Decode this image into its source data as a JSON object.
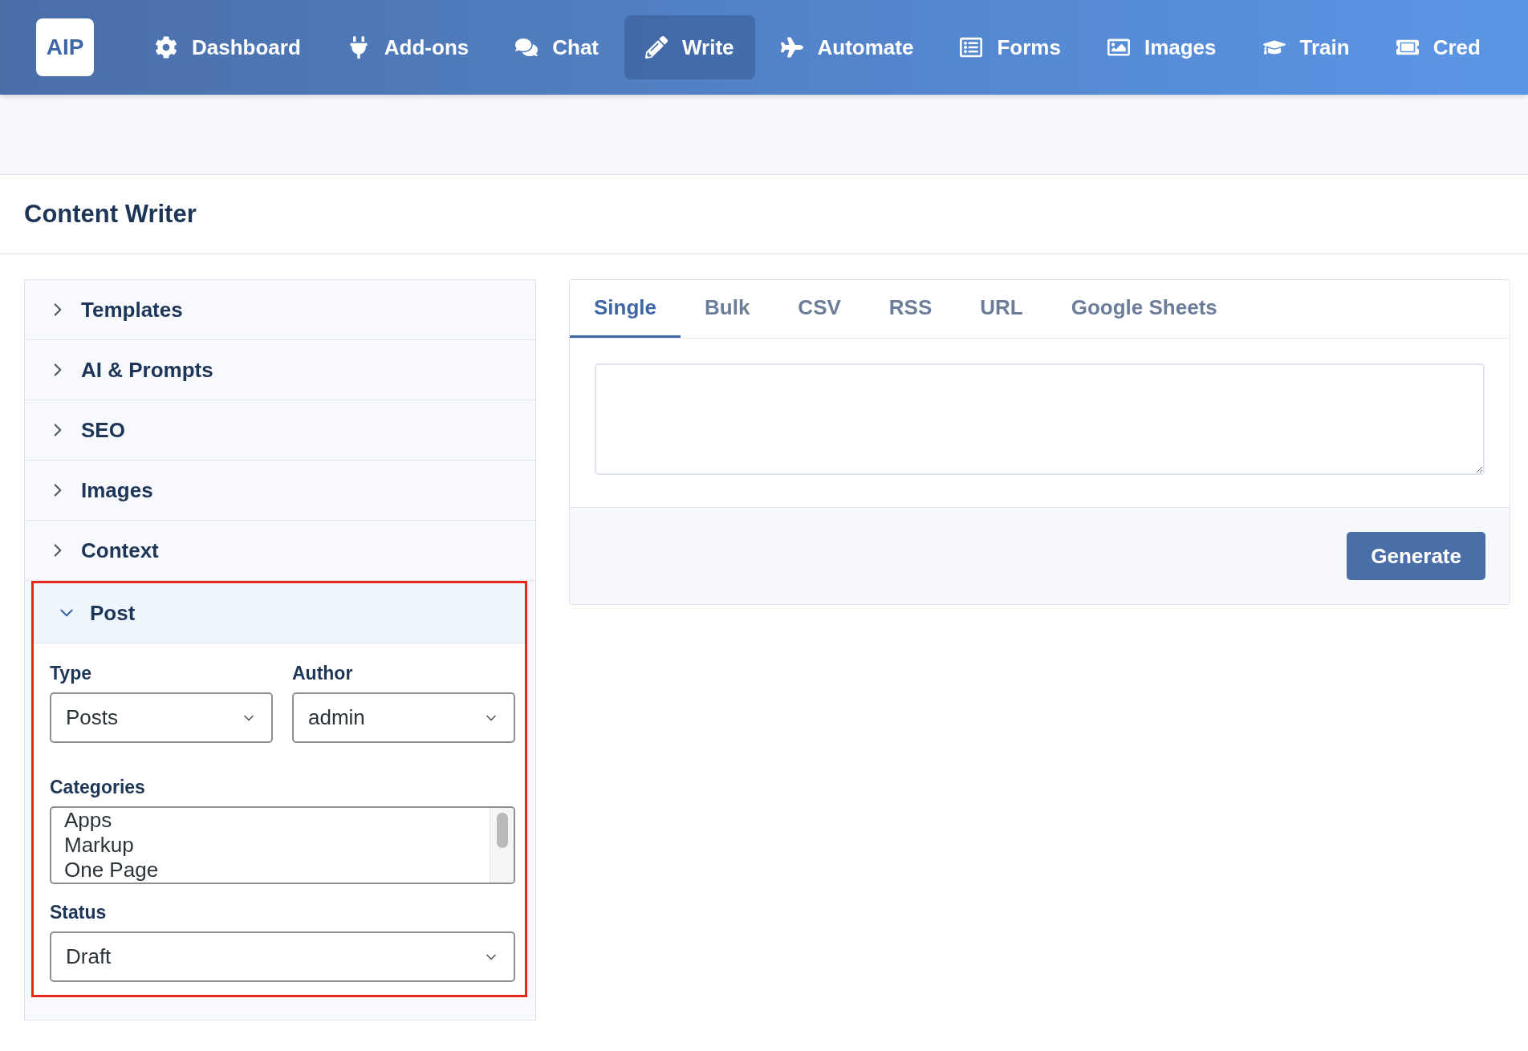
{
  "logo": "AIP",
  "nav": [
    {
      "label": "Dashboard",
      "selected": false
    },
    {
      "label": "Add-ons",
      "selected": false
    },
    {
      "label": "Chat",
      "selected": false
    },
    {
      "label": "Write",
      "selected": true
    },
    {
      "label": "Automate",
      "selected": false
    },
    {
      "label": "Forms",
      "selected": false
    },
    {
      "label": "Images",
      "selected": false
    },
    {
      "label": "Train",
      "selected": false
    },
    {
      "label": "Cred",
      "selected": false
    }
  ],
  "page_title": "Content Writer",
  "accordion": [
    {
      "label": "Templates",
      "expanded": false
    },
    {
      "label": "AI & Prompts",
      "expanded": false
    },
    {
      "label": "SEO",
      "expanded": false
    },
    {
      "label": "Images",
      "expanded": false
    },
    {
      "label": "Context",
      "expanded": false
    },
    {
      "label": "Post",
      "expanded": true,
      "highlighted": true,
      "type": {
        "label": "Type",
        "value": "Posts"
      },
      "author": {
        "label": "Author",
        "value": "admin"
      },
      "categories": {
        "label": "Categories",
        "options": [
          "Apps",
          "Markup",
          "One Page"
        ]
      },
      "status": {
        "label": "Status",
        "value": "Draft"
      }
    }
  ],
  "tabs": [
    {
      "label": "Single",
      "selected": true
    },
    {
      "label": "Bulk",
      "selected": false
    },
    {
      "label": "CSV",
      "selected": false
    },
    {
      "label": "RSS",
      "selected": false
    },
    {
      "label": "URL",
      "selected": false
    },
    {
      "label": "Google Sheets",
      "selected": false
    }
  ],
  "generate_button": "Generate"
}
